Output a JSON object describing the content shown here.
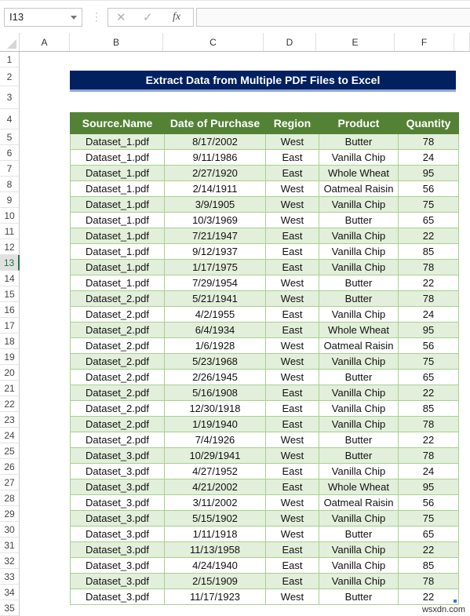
{
  "formula_bar": {
    "name_box": "I13",
    "cancel_icon": "✕",
    "enter_icon": "✓",
    "fx_label": "fx",
    "formula_value": ""
  },
  "columns": [
    "A",
    "B",
    "C",
    "D",
    "E",
    "F"
  ],
  "rows": [
    "1",
    "2",
    "3",
    "4",
    "5",
    "6",
    "7",
    "8",
    "9",
    "10",
    "11",
    "12",
    "13",
    "14",
    "15",
    "16",
    "17",
    "18",
    "19",
    "20",
    "21",
    "22",
    "23",
    "24",
    "25",
    "26",
    "27",
    "28",
    "29",
    "30",
    "31",
    "32",
    "33",
    "34",
    "35"
  ],
  "selected_row": "13",
  "title": "Extract Data from Multiple PDF Files to Excel",
  "table": {
    "headers": [
      "Source.Name",
      "Date of Purchase",
      "Region",
      "Product",
      "Quantity"
    ],
    "rows": [
      [
        "Dataset_1.pdf",
        "8/17/2002",
        "West",
        "Butter",
        "78"
      ],
      [
        "Dataset_1.pdf",
        "9/11/1986",
        "East",
        "Vanilla Chip",
        "24"
      ],
      [
        "Dataset_1.pdf",
        "2/27/1920",
        "East",
        "Whole Wheat",
        "95"
      ],
      [
        "Dataset_1.pdf",
        "2/14/1911",
        "West",
        "Oatmeal Raisin",
        "56"
      ],
      [
        "Dataset_1.pdf",
        "3/9/1905",
        "West",
        "Vanilla Chip",
        "75"
      ],
      [
        "Dataset_1.pdf",
        "10/3/1969",
        "West",
        "Butter",
        "65"
      ],
      [
        "Dataset_1.pdf",
        "7/21/1947",
        "East",
        "Vanilla Chip",
        "22"
      ],
      [
        "Dataset_1.pdf",
        "9/12/1937",
        "East",
        "Vanilla Chip",
        "85"
      ],
      [
        "Dataset_1.pdf",
        "1/17/1975",
        "East",
        "Vanilla Chip",
        "78"
      ],
      [
        "Dataset_1.pdf",
        "7/29/1954",
        "West",
        "Butter",
        "22"
      ],
      [
        "Dataset_2.pdf",
        "5/21/1941",
        "West",
        "Butter",
        "78"
      ],
      [
        "Dataset_2.pdf",
        "4/2/1955",
        "East",
        "Vanilla Chip",
        "24"
      ],
      [
        "Dataset_2.pdf",
        "6/4/1934",
        "East",
        "Whole Wheat",
        "95"
      ],
      [
        "Dataset_2.pdf",
        "1/6/1928",
        "West",
        "Oatmeal Raisin",
        "56"
      ],
      [
        "Dataset_2.pdf",
        "5/23/1968",
        "West",
        "Vanilla Chip",
        "75"
      ],
      [
        "Dataset_2.pdf",
        "2/26/1945",
        "West",
        "Butter",
        "65"
      ],
      [
        "Dataset_2.pdf",
        "5/16/1908",
        "East",
        "Vanilla Chip",
        "22"
      ],
      [
        "Dataset_2.pdf",
        "12/30/1918",
        "East",
        "Vanilla Chip",
        "85"
      ],
      [
        "Dataset_2.pdf",
        "1/19/1940",
        "East",
        "Vanilla Chip",
        "78"
      ],
      [
        "Dataset_2.pdf",
        "7/4/1926",
        "West",
        "Butter",
        "22"
      ],
      [
        "Dataset_3.pdf",
        "10/29/1941",
        "West",
        "Butter",
        "78"
      ],
      [
        "Dataset_3.pdf",
        "4/27/1952",
        "East",
        "Vanilla Chip",
        "24"
      ],
      [
        "Dataset_3.pdf",
        "4/21/2002",
        "East",
        "Whole Wheat",
        "95"
      ],
      [
        "Dataset_3.pdf",
        "3/11/2002",
        "West",
        "Oatmeal Raisin",
        "56"
      ],
      [
        "Dataset_3.pdf",
        "5/15/1902",
        "West",
        "Vanilla Chip",
        "75"
      ],
      [
        "Dataset_3.pdf",
        "1/11/1918",
        "West",
        "Butter",
        "65"
      ],
      [
        "Dataset_3.pdf",
        "11/13/1958",
        "East",
        "Vanilla Chip",
        "22"
      ],
      [
        "Dataset_3.pdf",
        "4/24/1940",
        "East",
        "Vanilla Chip",
        "85"
      ],
      [
        "Dataset_3.pdf",
        "2/15/1909",
        "East",
        "Vanilla Chip",
        "78"
      ],
      [
        "Dataset_3.pdf",
        "11/17/1923",
        "West",
        "Butter",
        "22"
      ]
    ]
  },
  "watermark": "wsxdn.com",
  "colors": {
    "title_bg": "#002060",
    "header_bg": "#548235",
    "band_bg": "#e2efda",
    "border": "#a9d08e"
  }
}
